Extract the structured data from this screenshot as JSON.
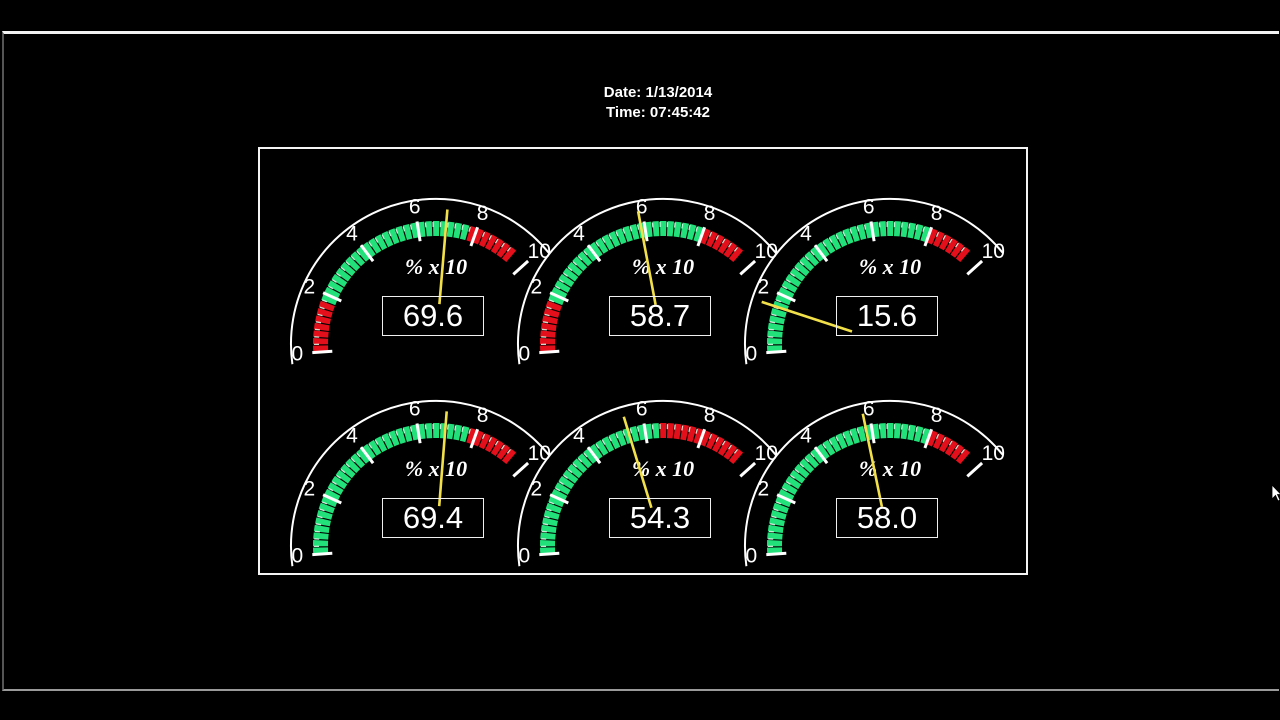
{
  "header": {
    "date_text": "Date: 1/13/2014",
    "time_text": "Time: 07:45:42"
  },
  "scale": {
    "labels": [
      "0",
      "2",
      "4",
      "6",
      "8",
      "10"
    ],
    "min": 0,
    "max": 10,
    "unit_label": "% x 10"
  },
  "colors": {
    "background": "#000000",
    "green": "#22e07a",
    "red": "#e3101c",
    "needle": "#f2e04a",
    "arc": "#ffffff",
    "text": "#ffffff"
  },
  "gauges": [
    {
      "value": 69.6,
      "display": "69.6",
      "bands": [
        {
          "from": 0,
          "to": 1.7,
          "color": "red"
        },
        {
          "from": 1.7,
          "to": 7.7,
          "color": "green"
        },
        {
          "from": 7.7,
          "to": 9.6,
          "color": "red"
        }
      ]
    },
    {
      "value": 58.7,
      "display": "58.7",
      "bands": [
        {
          "from": 0,
          "to": 1.7,
          "color": "red"
        },
        {
          "from": 1.7,
          "to": 8.0,
          "color": "green"
        },
        {
          "from": 8.0,
          "to": 9.6,
          "color": "red"
        }
      ]
    },
    {
      "value": 15.6,
      "display": "15.6",
      "bands": [
        {
          "from": 0,
          "to": 8.0,
          "color": "green"
        },
        {
          "from": 8.0,
          "to": 9.6,
          "color": "red"
        }
      ]
    },
    {
      "value": 69.4,
      "display": "69.4",
      "bands": [
        {
          "from": 0,
          "to": 7.7,
          "color": "green"
        },
        {
          "from": 7.7,
          "to": 9.6,
          "color": "red"
        }
      ]
    },
    {
      "value": 54.3,
      "display": "54.3",
      "bands": [
        {
          "from": 0,
          "to": 6.6,
          "color": "green"
        },
        {
          "from": 6.6,
          "to": 9.6,
          "color": "red"
        }
      ]
    },
    {
      "value": 58.0,
      "display": "58.0",
      "bands": [
        {
          "from": 0,
          "to": 8.0,
          "color": "green"
        },
        {
          "from": 8.0,
          "to": 9.6,
          "color": "red"
        }
      ]
    }
  ]
}
